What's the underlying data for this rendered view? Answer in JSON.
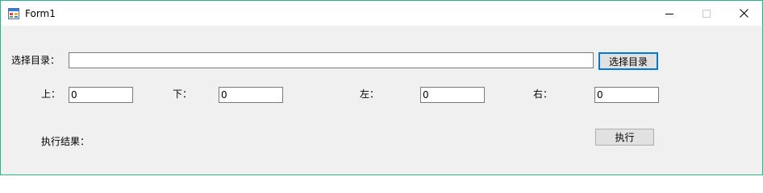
{
  "window": {
    "title": "Form1"
  },
  "form": {
    "dir_label": "选择目录：",
    "dir_value": "",
    "dir_button": "选择目录",
    "top_label": "上：",
    "top_value": "0",
    "bottom_label": "下：",
    "bottom_value": "0",
    "left_label": "左：",
    "left_value": "0",
    "right_label": "右：",
    "right_value": "0",
    "result_label": "执行结果：",
    "run_button": "执行"
  },
  "colors": {
    "window_border": "#2bb38a",
    "titlebar": "#ffffff",
    "client_bg": "#f0f0f0",
    "focus_accent": "#0078d7"
  },
  "icons": [
    "app-icon",
    "minimize-icon",
    "maximize-icon",
    "close-icon"
  ]
}
